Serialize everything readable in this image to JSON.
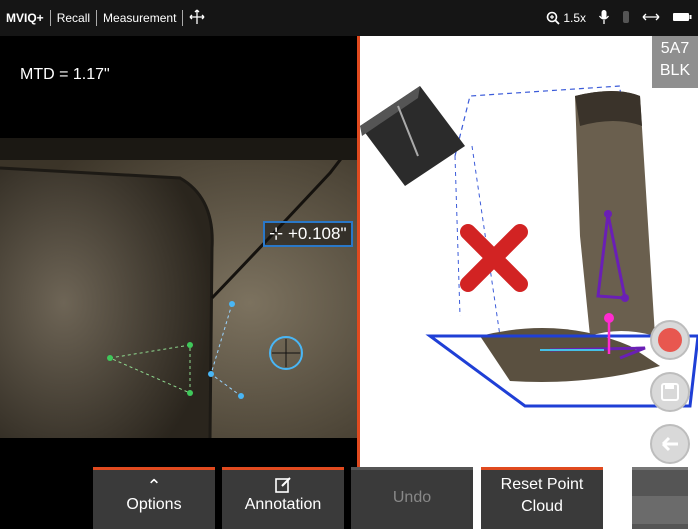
{
  "topbar": {
    "brand": "MVIQ+",
    "crumb_recall": "Recall",
    "crumb_measurement": "Measurement",
    "zoom": "1.5x"
  },
  "left_view": {
    "mtd": "MTD = 1.17\"",
    "depth_label": "+0.108\""
  },
  "right_view": {
    "badge_line1": "5A7",
    "badge_line2": "BLK"
  },
  "toolbar": {
    "options_label": "Options",
    "annotation_label": "Annotation",
    "undo_label": "Undo",
    "reset_label_1": "Reset Point",
    "reset_label_2": "Cloud"
  },
  "colors": {
    "accent": "#e04a1f",
    "measure_blue": "#2a78c8",
    "plane_blue": "#1f3fd6",
    "profile_purple": "#6a1fb5",
    "marker_pink": "#ff2bd0"
  }
}
